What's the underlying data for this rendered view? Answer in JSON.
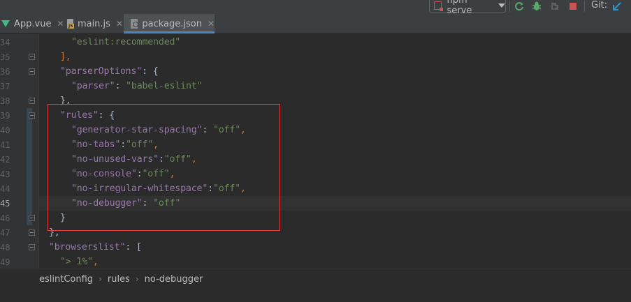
{
  "toolbar": {
    "run_config_label": "npm serve",
    "git_label": "Git:",
    "icons": [
      "run-config-icon",
      "rerun-icon",
      "debug-bug-icon",
      "coverage-icon",
      "stop-icon",
      "git-update-icon"
    ]
  },
  "tabs": [
    {
      "label": "App.vue",
      "icon": "vue-file-icon",
      "active": false
    },
    {
      "label": "main.js",
      "icon": "js-file-icon",
      "active": false
    },
    {
      "label": "package.json",
      "icon": "package-json-icon",
      "active": true
    }
  ],
  "tab_close_glyph": "✕",
  "editor": {
    "lines": [
      {
        "num": "34",
        "tokens": [
          {
            "t": "str",
            "v": "\"eslint:recommended\""
          }
        ]
      },
      {
        "num": "35",
        "tokens": [
          {
            "t": "punc",
            "v": "],"
          }
        ]
      },
      {
        "num": "36",
        "tokens": [
          {
            "t": "key",
            "v": "\"parserOptions\""
          },
          {
            "t": "plain",
            "v": ": {"
          }
        ]
      },
      {
        "num": "37",
        "tokens": [
          {
            "t": "key",
            "v": "\"parser\""
          },
          {
            "t": "plain",
            "v": ": "
          },
          {
            "t": "str",
            "v": "\"babel-eslint\""
          }
        ]
      },
      {
        "num": "38",
        "tokens": [
          {
            "t": "plain",
            "v": "},"
          }
        ]
      },
      {
        "num": "39",
        "tokens": [
          {
            "t": "key",
            "v": "\"rules\""
          },
          {
            "t": "plain",
            "v": ": {"
          }
        ]
      },
      {
        "num": "40",
        "tokens": [
          {
            "t": "key",
            "v": "\"generator-star-spacing\""
          },
          {
            "t": "plain",
            "v": ": "
          },
          {
            "t": "str",
            "v": "\"off\""
          },
          {
            "t": "punc",
            "v": ","
          }
        ]
      },
      {
        "num": "41",
        "tokens": [
          {
            "t": "key",
            "v": "\"no-tabs\""
          },
          {
            "t": "plain",
            "v": ":"
          },
          {
            "t": "str",
            "v": "\"off\""
          },
          {
            "t": "punc",
            "v": ","
          }
        ]
      },
      {
        "num": "42",
        "tokens": [
          {
            "t": "key",
            "v": "\"no-unused-vars\""
          },
          {
            "t": "plain",
            "v": ":"
          },
          {
            "t": "str",
            "v": "\"off\""
          },
          {
            "t": "punc",
            "v": ","
          }
        ]
      },
      {
        "num": "43",
        "tokens": [
          {
            "t": "key",
            "v": "\"no-console\""
          },
          {
            "t": "plain",
            "v": ":"
          },
          {
            "t": "str",
            "v": "\"off\""
          },
          {
            "t": "punc",
            "v": ","
          }
        ]
      },
      {
        "num": "44",
        "tokens": [
          {
            "t": "key",
            "v": "\"no-irregular-whitespace\""
          },
          {
            "t": "plain",
            "v": ":"
          },
          {
            "t": "str",
            "v": "\"off\""
          },
          {
            "t": "punc",
            "v": ","
          }
        ]
      },
      {
        "num": "45",
        "tokens": [
          {
            "t": "key",
            "v": "\"no-debugger\""
          },
          {
            "t": "plain",
            "v": ": "
          },
          {
            "t": "str",
            "v": "\"off\""
          }
        ]
      },
      {
        "num": "46",
        "tokens": [
          {
            "t": "plain",
            "v": "}"
          }
        ]
      },
      {
        "num": "47",
        "tokens": [
          {
            "t": "plain",
            "v": "},"
          }
        ]
      },
      {
        "num": "48",
        "tokens": [
          {
            "t": "key",
            "v": "\"browserslist\""
          },
          {
            "t": "plain",
            "v": ": ["
          }
        ]
      },
      {
        "num": "49",
        "tokens": [
          {
            "t": "str",
            "v": "\"> 1%\""
          },
          {
            "t": "punc",
            "v": ","
          }
        ]
      }
    ]
  },
  "breadcrumb": [
    "eslintConfig",
    "rules",
    "no-debugger"
  ],
  "breadcrumb_separator": "›",
  "colors": {
    "string": "#6a8759",
    "key": "#9876aa",
    "punctuation": "#cc7832",
    "highlight_box": "#e0403f",
    "active_tab_underline": "#4a88c7"
  }
}
